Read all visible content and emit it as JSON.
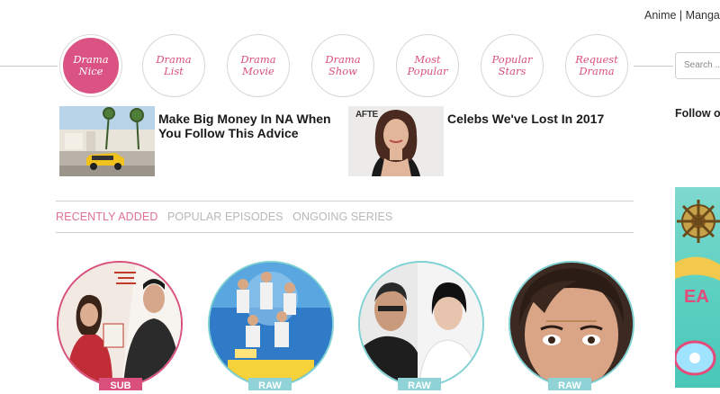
{
  "header": {
    "links": [
      "Anime",
      "Manga"
    ],
    "separator": "|"
  },
  "nav": {
    "items": [
      {
        "label": "Drama Nice",
        "active": true
      },
      {
        "label": "Drama List",
        "active": false
      },
      {
        "label": "Drama Movie",
        "active": false
      },
      {
        "label": "Drama Show",
        "active": false
      },
      {
        "label": "Most Popular",
        "active": false
      },
      {
        "label": "Popular Stars",
        "active": false
      },
      {
        "label": "Request Drama",
        "active": false
      }
    ]
  },
  "search": {
    "placeholder": "Search ..."
  },
  "sidebar": {
    "follow_text": "Follow o"
  },
  "ads": [
    {
      "title": "Make Big Money In NA When You Follow This Advice"
    },
    {
      "title": "Celebs We've Lost In 2017",
      "thumb_text": "AFTE"
    }
  ],
  "tabs": [
    {
      "label": "RECENTLY ADDED",
      "active": true
    },
    {
      "label": "POPULAR EPISODES",
      "active": false
    },
    {
      "label": "ONGOING SERIES",
      "active": false
    }
  ],
  "posters": [
    {
      "badge": "SUB",
      "border_color": "#d9507c"
    },
    {
      "badge": "RAW",
      "border_color": "#7fd1d4"
    },
    {
      "badge": "RAW",
      "border_color": "#7fd1d4"
    },
    {
      "badge": "RAW",
      "border_color": "#7fd1d4"
    }
  ],
  "colors": {
    "brand_pink": "#da5383",
    "tab_active": "#e07194",
    "raw_badge": "#8fd3d6",
    "sub_badge": "#d9507c"
  }
}
